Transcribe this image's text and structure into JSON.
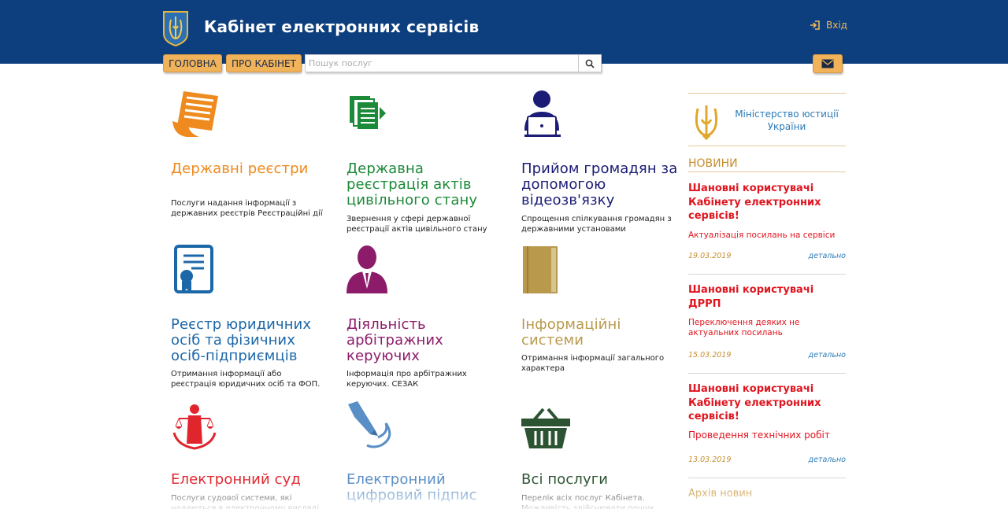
{
  "header": {
    "title": "Кабінет електронних сервісів",
    "login_label": "Вхід",
    "logo_icon": "ukraine-coat-of-arms-icon",
    "nav": {
      "home": "ГОЛОВНА",
      "about": "ПРО КАБІНЕТ"
    },
    "search": {
      "placeholder": "Пошук послуг",
      "value": ""
    },
    "colors": {
      "header_bg": "#0d3f7e",
      "button_bg": "#f0b35a"
    }
  },
  "services": [
    {
      "title": "Державні реєстри",
      "desc": "Послуги надання інформації з державних реєстрів Реєстраційні дії",
      "icon": "document-list-icon",
      "color": "#ef8a1e"
    },
    {
      "title": "Державна реєстрація актів цивільного стану",
      "desc": "Звернення у сфері державної реєстрації актів цивільного стану",
      "icon": "documents-arrow-icon",
      "color": "#1d8a3a"
    },
    {
      "title": "Прийом громадян за допомогою відеозв'язку",
      "desc": "Спрощення спілкування громадян з державними установами",
      "icon": "person-laptop-icon",
      "color": "#1b1c75"
    },
    {
      "title": "Реєстр юридичних осіб та фізичних осіб-підприємців",
      "desc": "Отримання інформації або реєстрація юридичних осіб та ФОП.",
      "icon": "certificate-icon",
      "color": "#1c67a8"
    },
    {
      "title": "Діяльність арбітражних керуючих",
      "desc": "Інформація про арбітражних керуючих. СЕЗАК",
      "icon": "businessman-icon",
      "color": "#8c1c6a"
    },
    {
      "title": "Інформаційні системи",
      "desc": "Отримання інформації загального характера",
      "icon": "book-icon",
      "color": "#b99a4c"
    },
    {
      "title": "Електронний суд",
      "desc": "Послуги судової системи, які надаються в електронному вигляді",
      "icon": "justice-icon",
      "color": "#e0252d"
    },
    {
      "title": "Електронний цифровий підпис",
      "desc": "",
      "icon": "pen-nib-icon",
      "color": "#5a8ec6"
    },
    {
      "title": "Всі послуги",
      "desc": "Перелік всіх послуг Кабінета. Можливість здійснювати пошук послуг",
      "icon": "basket-icon",
      "color": "#2d5432"
    }
  ],
  "sidebar": {
    "ministry": "Міністерство юстиції України",
    "ministry_icon": "trident-icon",
    "news_heading": "НОВИНИ",
    "news": [
      {
        "title": "Шановні користувачі Кабінету електронних сервісів!",
        "subtitle": "Актуалізація посилань на сервіси",
        "date": "19.03.2019",
        "more": "детально"
      },
      {
        "title": "Шановні користувачі ДРРП",
        "subtitle": "Переключення деяких не актуальних посилань",
        "date": "15.03.2019",
        "more": "детально"
      },
      {
        "title": "Шановні користувачі Кабінету електронних сервісів!",
        "subtitle": "Проведення технічних робіт",
        "date": "13.03.2019",
        "more": "детально"
      }
    ],
    "archive_label": "Архів новин",
    "colors": {
      "news_title": "#e0151f",
      "date": "#c58d2d",
      "link": "#2a7bb8"
    }
  }
}
